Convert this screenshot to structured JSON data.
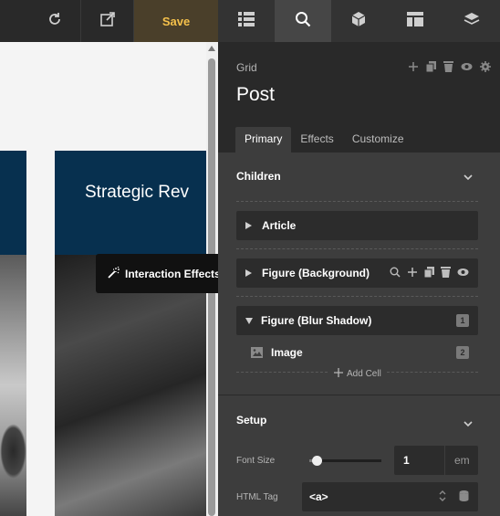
{
  "topbar": {
    "save_label": "Save",
    "left_icons": [
      "refresh-icon",
      "external-link-icon"
    ],
    "right_icons": [
      "list-icon",
      "search-icon",
      "cube-icon",
      "layout-icon",
      "layers-icon"
    ],
    "active_right": "search-icon",
    "save_color": "#f5c14b"
  },
  "canvas": {
    "card_title": "Strategic Rev",
    "tooltip_label": "Interaction Effects"
  },
  "panel": {
    "kind": "Grid",
    "title": "Post",
    "tabs": [
      {
        "label": "Primary",
        "active": true
      },
      {
        "label": "Effects",
        "active": false
      },
      {
        "label": "Customize",
        "active": false
      }
    ],
    "children": {
      "heading": "Children",
      "items": [
        {
          "label": "Article",
          "expanded": false
        },
        {
          "label": "Figure (Background)",
          "expanded": false
        },
        {
          "label": "Figure (Blur Shadow)",
          "expanded": true,
          "badge": "1"
        }
      ],
      "sub_item": {
        "label": "Image",
        "badge": "2"
      },
      "add_cell": "Add Cell"
    },
    "setup": {
      "heading": "Setup",
      "font_size_label": "Font Size",
      "font_size_value": "1",
      "font_size_unit": "em",
      "font_size_slider": 0.1,
      "html_tag_label": "HTML Tag",
      "html_tag_value": "<a>"
    }
  }
}
